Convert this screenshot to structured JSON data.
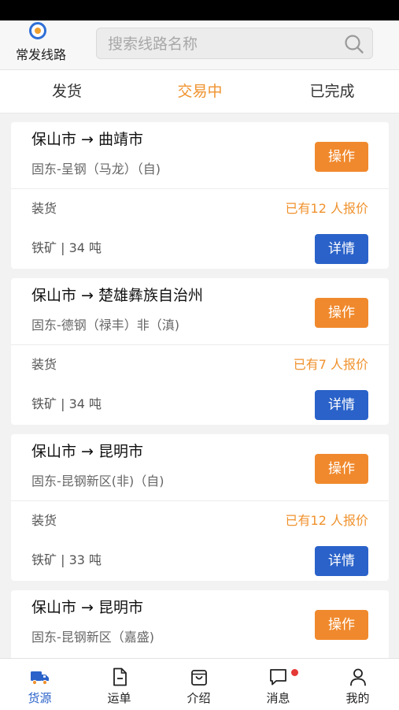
{
  "header": {
    "route_label": "常发线路",
    "search_placeholder": "搜索线路名称"
  },
  "tabs": [
    {
      "label": "发货",
      "active": false
    },
    {
      "label": "交易中",
      "active": true
    },
    {
      "label": "已完成",
      "active": false
    }
  ],
  "cards": [
    {
      "route": "保山市 → 曲靖市",
      "company": "固东-呈钢（马龙）（自)",
      "status": "装货",
      "quote": "已有12 人报价",
      "cargo": "铁矿 | 34 吨",
      "op_label": "操作",
      "detail_label": "详情"
    },
    {
      "route": "保山市 → 楚雄彝族自治州",
      "company": "固东-德钢（禄丰）非（滇)",
      "status": "装货",
      "quote": "已有7 人报价",
      "cargo": "铁矿 | 34 吨",
      "op_label": "操作",
      "detail_label": "详情"
    },
    {
      "route": "保山市 → 昆明市",
      "company": "固东-昆钢新区(非)（自)",
      "status": "装货",
      "quote": "已有12 人报价",
      "cargo": "铁矿 | 33 吨",
      "op_label": "操作",
      "detail_label": "详情"
    },
    {
      "route": "保山市 → 昆明市",
      "company": "固东-昆钢新区（嘉盛)",
      "status": "",
      "quote": "",
      "cargo": "",
      "op_label": "操作",
      "detail_label": ""
    }
  ],
  "tabbar": [
    {
      "label": "货源",
      "icon": "truck-icon",
      "active": true
    },
    {
      "label": "运单",
      "icon": "document-icon",
      "active": false
    },
    {
      "label": "介绍",
      "icon": "bag-icon",
      "active": false
    },
    {
      "label": "消息",
      "icon": "chat-icon",
      "active": false,
      "badge": true
    },
    {
      "label": "我的",
      "icon": "user-icon",
      "active": false
    }
  ],
  "colors": {
    "accent_orange": "#f0892d",
    "accent_blue": "#2a62c9",
    "badge_red": "#e53935"
  }
}
